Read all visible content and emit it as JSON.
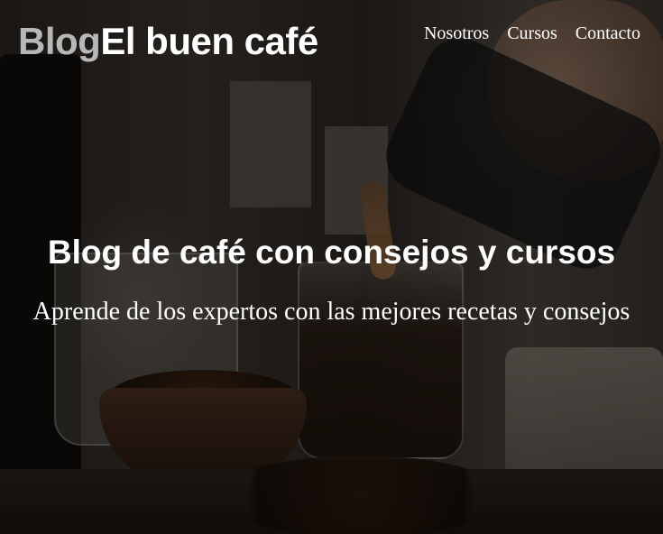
{
  "header": {
    "logo_prefix": "Blog",
    "logo_main": "El buen café",
    "nav": [
      {
        "label": "Nosotros"
      },
      {
        "label": "Cursos"
      },
      {
        "label": "Contacto"
      }
    ]
  },
  "hero": {
    "title": "Blog de café con consejos y cursos",
    "subtitle": "Aprende de los expertos con las mejores recetas y consejos"
  },
  "colors": {
    "text": "#ffffff",
    "logo_prefix": "#b7b7b7"
  }
}
